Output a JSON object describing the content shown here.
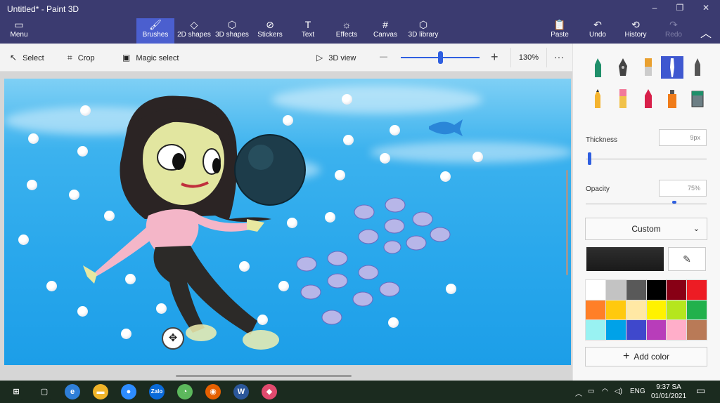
{
  "window": {
    "title": "Untitled* - Paint 3D",
    "minimize": "–",
    "maximize": "❐",
    "close": "✕"
  },
  "ribbon": {
    "menu": "Menu",
    "tools": [
      {
        "label": "Brushes",
        "icon": "🖌"
      },
      {
        "label": "2D shapes",
        "icon": "◇"
      },
      {
        "label": "3D shapes",
        "icon": "⬡"
      },
      {
        "label": "Stickers",
        "icon": "⊘"
      },
      {
        "label": "Text",
        "icon": "T"
      },
      {
        "label": "Effects",
        "icon": "☼"
      },
      {
        "label": "Canvas",
        "icon": "#"
      },
      {
        "label": "3D library",
        "icon": "⬡"
      }
    ],
    "paste": "Paste",
    "undo": "Undo",
    "history": "History",
    "redo": "Redo"
  },
  "toolbar": {
    "select": "Select",
    "crop": "Crop",
    "magic_select": "Magic select",
    "view_3d": "3D view",
    "zoom_minus": "—",
    "zoom_plus": "+",
    "zoom_value": "130%",
    "more": "···",
    "zoom_fraction": 0.5
  },
  "panel": {
    "thickness_label": "Thickness",
    "thickness_value": "9px",
    "opacity_label": "Opacity",
    "opacity_value": "75%",
    "custom_label": "Custom",
    "add_color": "Add color",
    "selected_color": "#222222",
    "palette": [
      "#ffffff",
      "#c3c3c3",
      "#595959",
      "#000000",
      "#880015",
      "#ed1c24",
      "#ff7f27",
      "#ffc90e",
      "#ffe8a4",
      "#fff200",
      "#b5e61d",
      "#22b14c",
      "#99f2f2",
      "#00a2e8",
      "#3f48cc",
      "#b83dba",
      "#ffaec9",
      "#b97a57"
    ]
  },
  "taskbar": {
    "language": "ENG",
    "time": "9:37 SA",
    "date": "01/01/2021",
    "apps": [
      {
        "name": "windows-start-icon",
        "glyph": "⊞",
        "color": "#1b2b1f"
      },
      {
        "name": "task-view-icon",
        "glyph": "▢",
        "color": "#1b2b1f"
      },
      {
        "name": "edge-browser-icon",
        "glyph": "e",
        "color": "#2f7fd8"
      },
      {
        "name": "file-explorer-icon",
        "glyph": "▬",
        "color": "#f0b429"
      },
      {
        "name": "zoom-meetings-icon",
        "glyph": "●",
        "color": "#2d8cff"
      },
      {
        "name": "zalo-icon",
        "glyph": "Zalo",
        "color": "#0a6ad8"
      },
      {
        "name": "green-app-icon",
        "glyph": "◔",
        "color": "#5cb85c"
      },
      {
        "name": "firefox-icon",
        "glyph": "◉",
        "color": "#e66000"
      },
      {
        "name": "word-icon",
        "glyph": "W",
        "color": "#2b579a"
      },
      {
        "name": "paint-3d-icon",
        "glyph": "◆",
        "color": "#e14a6e"
      }
    ]
  }
}
